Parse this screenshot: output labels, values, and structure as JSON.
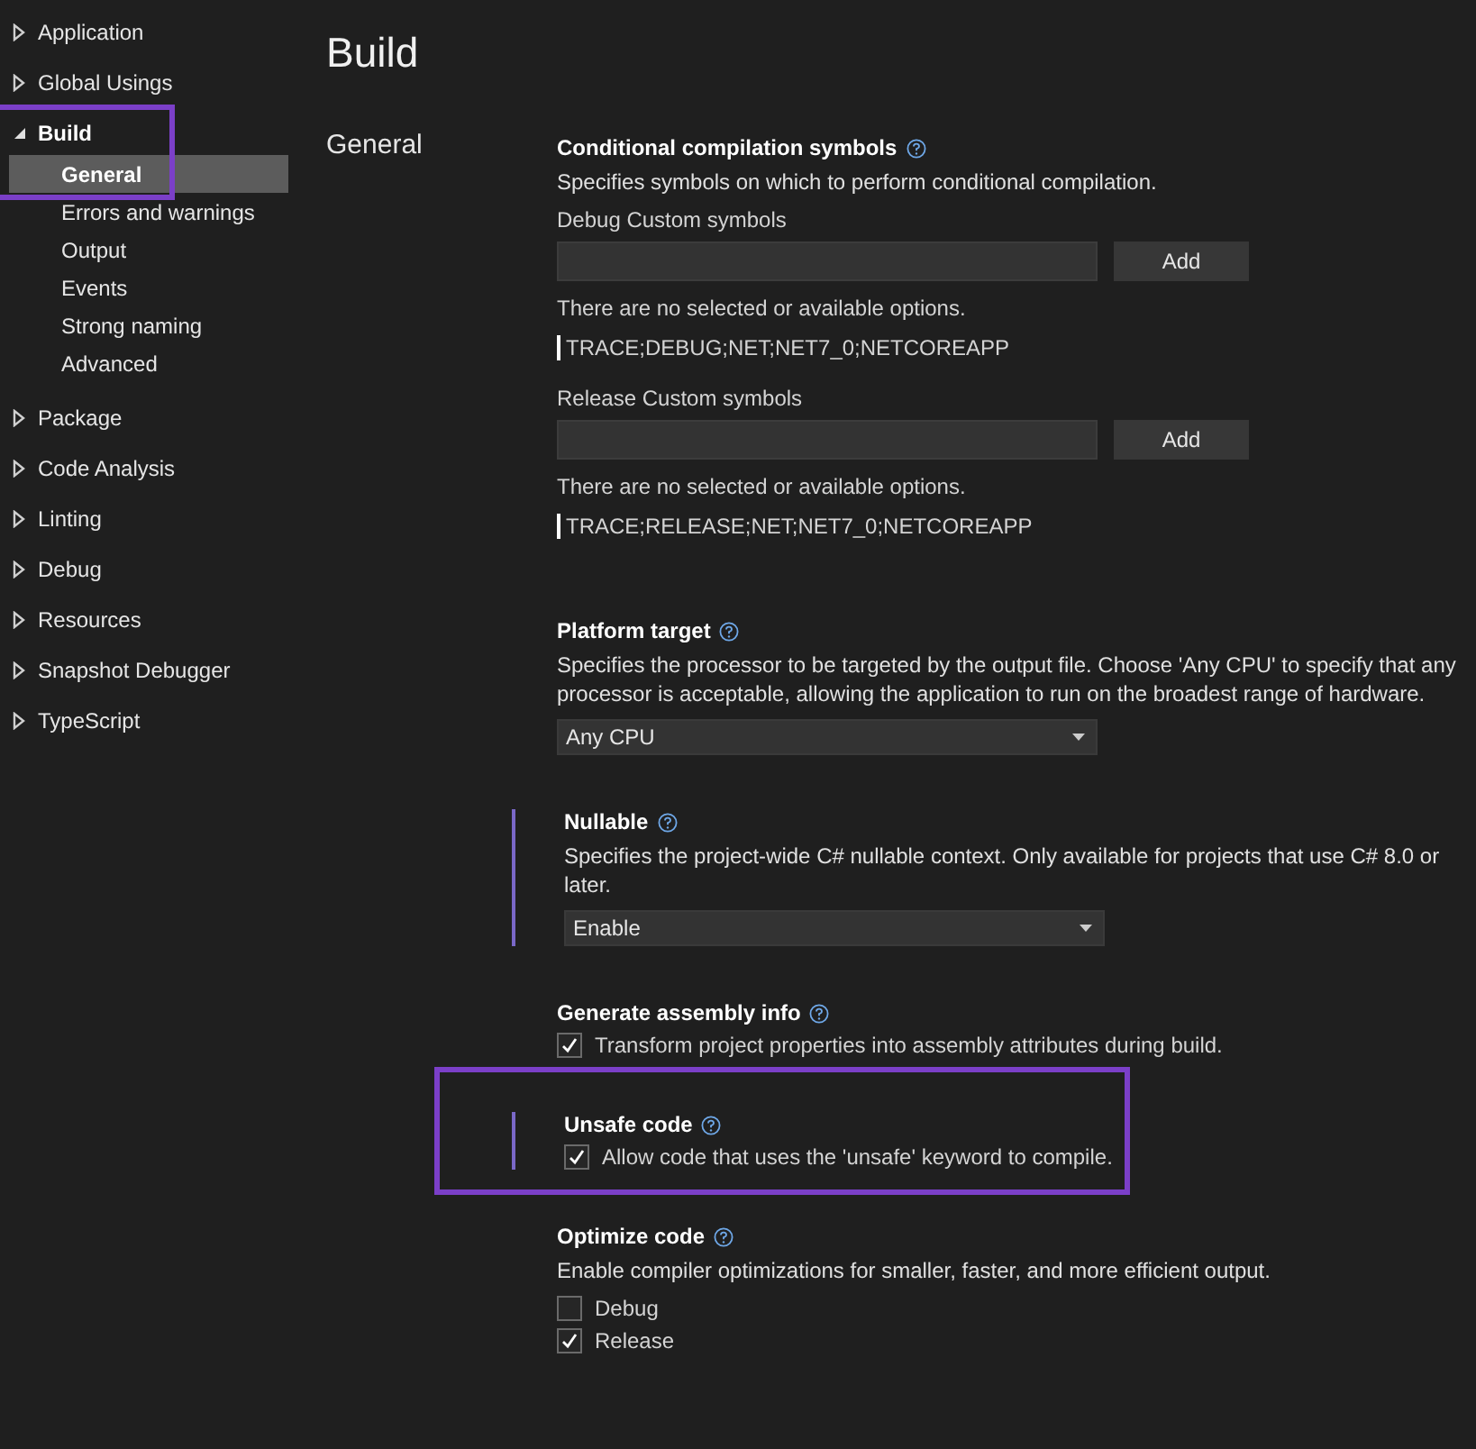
{
  "sidebar": {
    "items": [
      {
        "label": "Application",
        "expanded": false,
        "selected": false,
        "annotated": false
      },
      {
        "label": "Global Usings",
        "expanded": false,
        "selected": false,
        "annotated": false
      },
      {
        "label": "Build",
        "expanded": true,
        "selected": false,
        "annotated": true,
        "children": [
          {
            "label": "General",
            "selected": true
          },
          {
            "label": "Errors and warnings",
            "selected": false
          },
          {
            "label": "Output",
            "selected": false
          },
          {
            "label": "Events",
            "selected": false
          },
          {
            "label": "Strong naming",
            "selected": false
          },
          {
            "label": "Advanced",
            "selected": false
          }
        ]
      },
      {
        "label": "Package",
        "expanded": false,
        "selected": false,
        "annotated": false
      },
      {
        "label": "Code Analysis",
        "expanded": false,
        "selected": false,
        "annotated": false
      },
      {
        "label": "Linting",
        "expanded": false,
        "selected": false,
        "annotated": false
      },
      {
        "label": "Debug",
        "expanded": false,
        "selected": false,
        "annotated": false
      },
      {
        "label": "Resources",
        "expanded": false,
        "selected": false,
        "annotated": false
      },
      {
        "label": "Snapshot Debugger",
        "expanded": false,
        "selected": false,
        "annotated": false
      },
      {
        "label": "TypeScript",
        "expanded": false,
        "selected": false,
        "annotated": false
      }
    ]
  },
  "page_title": "Build",
  "section": "General",
  "settings": [
    {
      "kind": "symbols",
      "title": "Conditional compilation symbols",
      "modified": false,
      "annotated": false,
      "description": "Specifies symbols on which to perform conditional compilation.",
      "groups": [
        {
          "label": "Debug Custom symbols",
          "button": "Add",
          "note": "There are no selected or available options.",
          "symbols_text": "TRACE;DEBUG;NET;NET7_0;NETCOREAPP"
        },
        {
          "label": "Release Custom symbols",
          "button": "Add",
          "note": "There are no selected or available options.",
          "symbols_text": "TRACE;RELEASE;NET;NET7_0;NETCOREAPP"
        }
      ]
    },
    {
      "kind": "dropdown",
      "title": "Platform target",
      "modified": false,
      "annotated": false,
      "description": "Specifies the processor to be targeted by the output file. Choose 'Any CPU' to specify that any processor is acceptable, allowing the application to run on the broadest range of hardware.",
      "value": "Any CPU"
    },
    {
      "kind": "dropdown",
      "title": "Nullable",
      "modified": true,
      "annotated": false,
      "description": "Specifies the project-wide C# nullable context. Only available for projects that use C# 8.0 or later.",
      "value": "Enable"
    },
    {
      "kind": "checkbox",
      "title": "Generate assembly info",
      "modified": false,
      "annotated": false,
      "options": [
        {
          "label": "Transform project properties into assembly attributes during build.",
          "checked": true
        }
      ]
    },
    {
      "kind": "checkbox",
      "title": "Unsafe code",
      "modified": true,
      "annotated": true,
      "options": [
        {
          "label": "Allow code that uses the 'unsafe' keyword to compile.",
          "checked": true
        }
      ]
    },
    {
      "kind": "checkbox",
      "title": "Optimize code",
      "modified": false,
      "annotated": false,
      "description": "Enable compiler optimizations for smaller, faster, and more efficient output.",
      "options": [
        {
          "label": "Debug",
          "checked": false
        },
        {
          "label": "Release",
          "checked": true
        }
      ]
    }
  ]
}
